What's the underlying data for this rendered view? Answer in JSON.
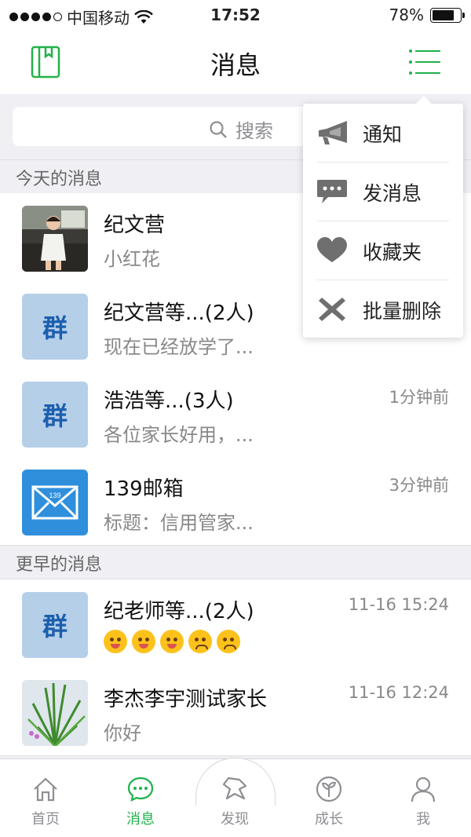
{
  "status_bar": {
    "carrier": "中国移动",
    "time": "17:52",
    "battery": "78%"
  },
  "nav": {
    "title": "消息"
  },
  "search": {
    "placeholder": "搜索"
  },
  "sections": {
    "today": "今天的消息",
    "earlier": "更早的消息"
  },
  "messages": [
    {
      "name": "纪文营",
      "preview": "小红花",
      "time": ""
    },
    {
      "name": "纪文营等...(2人)",
      "preview": "现在已经放学了...",
      "time": "",
      "avatar_text": "群"
    },
    {
      "name": "浩浩等...(3人)",
      "preview": "各位家长好用，...",
      "time": "1分钟前",
      "avatar_text": "群"
    },
    {
      "name": "139邮箱",
      "preview": "标题：信用管家...",
      "time": "3分钟前",
      "badge": "139"
    },
    {
      "name": "纪老师等...(2人)",
      "preview": "",
      "time": "11-16 15:24",
      "avatar_text": "群"
    },
    {
      "name": "李杰李宇测试家长",
      "preview": "你好",
      "time": "11-16 12:24"
    }
  ],
  "menu": [
    {
      "label": "通知",
      "icon": "megaphone-icon"
    },
    {
      "label": "发消息",
      "icon": "chat-bubble-icon"
    },
    {
      "label": "收藏夹",
      "icon": "heart-icon"
    },
    {
      "label": "批量删除",
      "icon": "x-icon"
    }
  ],
  "tabs": [
    {
      "label": "首页",
      "icon": "home-icon"
    },
    {
      "label": "消息",
      "icon": "message-icon"
    },
    {
      "label": "发现",
      "icon": "discover-icon"
    },
    {
      "label": "成长",
      "icon": "sprout-icon"
    },
    {
      "label": "我",
      "icon": "person-icon"
    }
  ],
  "colors": {
    "accent": "#22b14c",
    "group_avatar_bg": "#b6cfe8",
    "group_avatar_text": "#1d5fae",
    "mail_blue": "#2f8fdc"
  }
}
